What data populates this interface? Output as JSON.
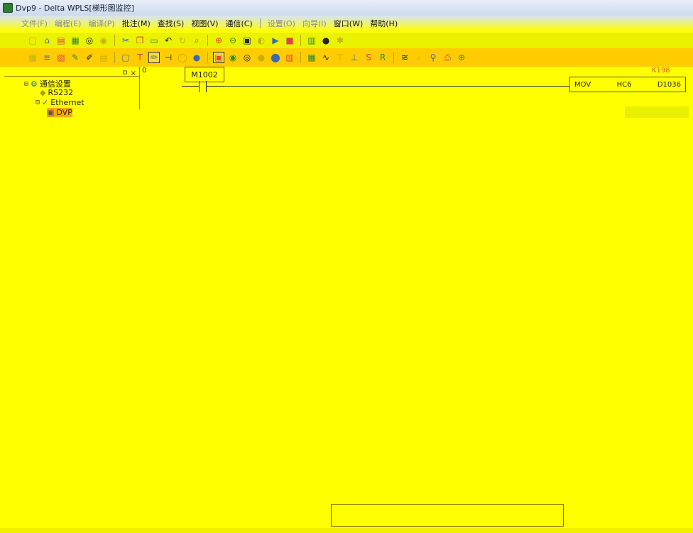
{
  "window": {
    "title": "Dvp9 - Delta WPLS[梯形图监控]",
    "colors": {
      "workspace": "#ffff00",
      "titlebar": "#cdd9ec",
      "toolbar": "#ffcc00"
    }
  },
  "menu": {
    "items": [
      {
        "label": "文件(F)",
        "disabled": true
      },
      {
        "label": "编程(E)",
        "disabled": true
      },
      {
        "label": "编译(P)",
        "disabled": true
      },
      {
        "label": "批注(M)",
        "disabled": false
      },
      {
        "label": "查找(S)",
        "disabled": false
      },
      {
        "label": "视图(V)",
        "disabled": false
      },
      {
        "label": "通信(C)",
        "disabled": false
      },
      {
        "label": "设置(O)",
        "disabled": true
      },
      {
        "label": "向导(I)",
        "disabled": true
      },
      {
        "label": "窗口(W)",
        "disabled": false
      },
      {
        "label": "帮助(H)",
        "disabled": false
      }
    ]
  },
  "toolbar1": {
    "icons": [
      "new-icon",
      "open-icon",
      "save-icon",
      "save-all-icon",
      "compile-icon",
      "compile-all-icon",
      "cut-icon",
      "copy-icon",
      "paste-icon",
      "undo-icon",
      "refresh-icon",
      "zoom-fit-icon",
      "zoom-in-icon",
      "zoom-out-icon",
      "monitor-icon",
      "online-icon",
      "run-icon",
      "stop-icon",
      "device-icon",
      "record-icon",
      "settings-icon"
    ]
  },
  "toolbar2": {
    "icons": [
      "ladder-icon",
      "instruction-icon",
      "sfc-icon",
      "comment-icon",
      "edit-icon",
      "table-icon",
      "view-icon",
      "text-icon",
      "pen-icon",
      "contact-icon",
      "coil-icon",
      "bulb-icon",
      "ladder-mode-icon",
      "monitor-start-icon",
      "monitor-stop-icon",
      "circle-red-icon",
      "circle-stop-icon",
      "device-monitor-icon",
      "register-icon",
      "wave-icon",
      "force-on-icon",
      "force-off-icon",
      "set-icon",
      "reset-icon",
      "trend-icon",
      "search-icon",
      "find-icon",
      "print-icon",
      "zoom-icon"
    ]
  },
  "project_tree": {
    "pin_label": "ㅁ ×",
    "items": [
      {
        "label": "通信设置",
        "expander": "⊟",
        "indent": 0
      },
      {
        "label": "RS232",
        "expander": "",
        "indent": 1
      },
      {
        "label": "Ethernet",
        "expander": "⊟",
        "indent": 1
      },
      {
        "label": "DVP",
        "expander": "",
        "indent": 2
      }
    ]
  },
  "ladder": {
    "rung_number": "0",
    "contact": "M1002",
    "instruction": {
      "op": "MOV",
      "src": "HC6",
      "dst": "D1036"
    },
    "k_value": "K198"
  }
}
